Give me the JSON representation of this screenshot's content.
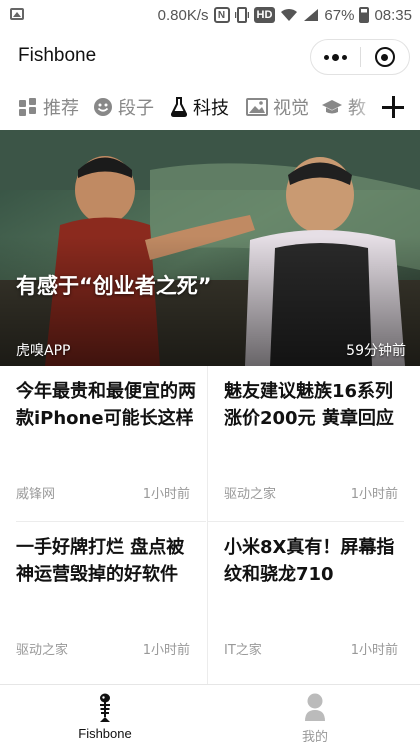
{
  "status_bar": {
    "speed": "0.80K/s",
    "hd": "HD",
    "battery": "67%",
    "time": "08:35"
  },
  "header": {
    "title": "Fishbone"
  },
  "tabs": [
    {
      "label": "推荐",
      "icon": "grid-icon",
      "active": false
    },
    {
      "label": "段子",
      "icon": "smiley-icon",
      "active": false
    },
    {
      "label": "科技",
      "icon": "flask-icon",
      "active": true
    },
    {
      "label": "视觉",
      "icon": "image-icon",
      "active": false
    },
    {
      "label": "教",
      "icon": "graduation-cap-icon",
      "active": false
    }
  ],
  "hero": {
    "title": "有感于“创业者之死”",
    "source": "虎嗅APP",
    "time": "59分钟前"
  },
  "articles": [
    {
      "title": "今年最贵和最便宜的两款iPhone可能长这样",
      "source": "威锋网",
      "time": "1小时前"
    },
    {
      "title": "魅友建议魅族16系列涨价200元 黄章回应",
      "source": "驱动之家",
      "time": "1小时前"
    },
    {
      "title": "一手好牌打烂 盘点被神运营毁掉的好软件",
      "source": "驱动之家",
      "time": "1小时前"
    },
    {
      "title": "小米8X真有！屏幕指纹和骁龙710",
      "source": "IT之家",
      "time": "1小时前"
    }
  ],
  "bottom_nav": [
    {
      "label": "Fishbone",
      "icon": "fishbone-icon",
      "active": true
    },
    {
      "label": "我的",
      "icon": "person-icon",
      "active": false
    }
  ],
  "colors": {
    "active": "#111111",
    "inactive": "#888888",
    "meta": "#999999"
  }
}
